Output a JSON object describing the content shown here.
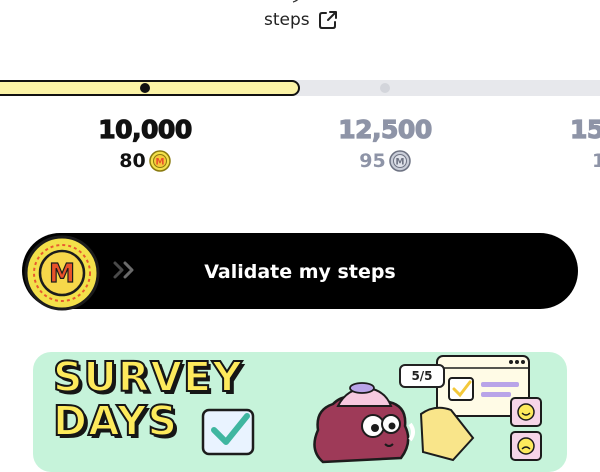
{
  "header": {
    "link_label": "steps",
    "link_icon": "external-link-icon"
  },
  "progress": {
    "reached_milestones": 1,
    "total_visible_milestones": 3
  },
  "milestones": [
    {
      "steps": "10,000",
      "reward": "80",
      "state": "reached",
      "coin_icon": "gold-coin-icon"
    },
    {
      "steps": "12,500",
      "reward": "95",
      "state": "upcoming",
      "coin_icon": "silver-coin-icon"
    },
    {
      "steps": "15",
      "reward": "1",
      "state": "upcoming",
      "coin_icon": "silver-coin-icon"
    }
  ],
  "validate": {
    "label": "Validate my steps",
    "coin_letter": "M",
    "icon": "double-chevron-right-icon"
  },
  "banner": {
    "title_line1": "SURVEY",
    "title_line2": "DAYS",
    "progress_tag": "5/5"
  },
  "colors": {
    "progress_fill": "#fbf3a6",
    "track": "#e7e8ec",
    "coin_gold": "#f3e04a",
    "coin_letter": "#e8522a",
    "banner_bg": "#c6f3da",
    "banner_title": "#fdea5c",
    "upcoming_text": "#8e94a7"
  }
}
